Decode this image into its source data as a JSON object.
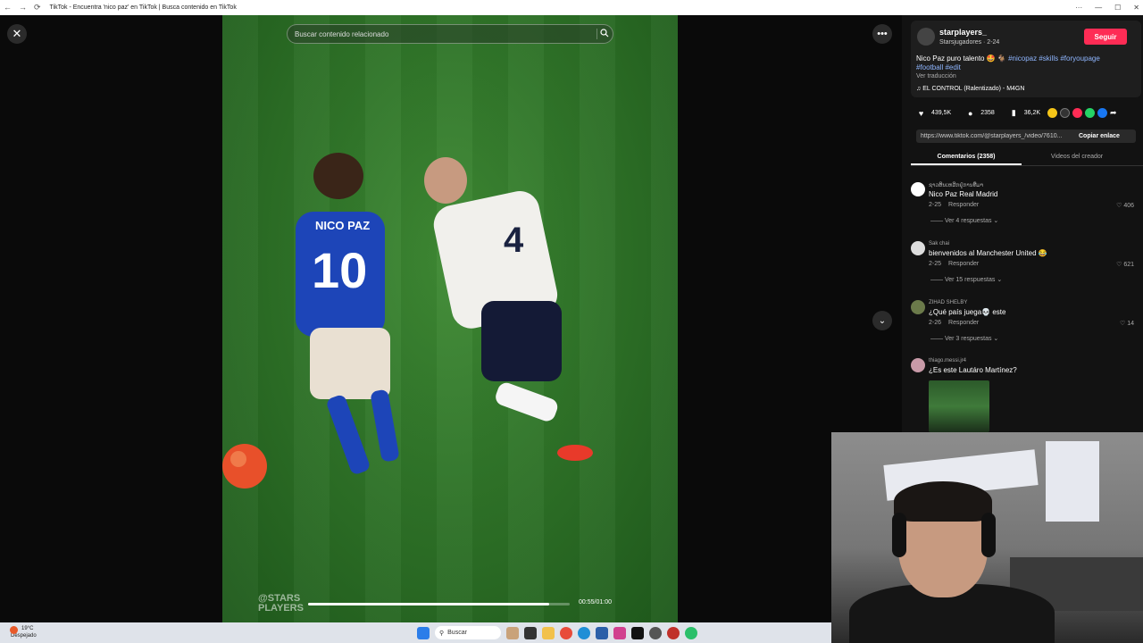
{
  "browser": {
    "tab_title": "TikTok - Encuentra 'nico paz' en TikTok | Busca contenido en TikTok",
    "nav_back": "←",
    "nav_forward": "→",
    "nav_reload": "⟳",
    "win_min": "—",
    "win_max": "☐",
    "win_close": "✕",
    "win_menu": "···"
  },
  "player": {
    "close_label": "✕",
    "search_placeholder": "Buscar contenido relacionado",
    "watermark_line1": "@STARS",
    "watermark_line2": "PLAYERS",
    "time": "00:55/01:00",
    "progress": 0.92,
    "more_label": "•••",
    "down_label": "⌄"
  },
  "post": {
    "username": "starplayers_",
    "subline": "Starsjugadores · 2-24",
    "follow_label": "Seguir",
    "description": "Nico Paz puro talento 🤩 🐐 ",
    "hashtags_line1": "#nicopaz #skills #foryoupage",
    "hashtags_line2": "#football #edit",
    "translate": "Ver traducción",
    "music": "♫  EL CONTROL (Ralentizado) - M4GN",
    "likes": "439,5K",
    "comments": "2358",
    "saves": "36,2K",
    "url": "https://www.tiktok.com/@starplayers_/video/7610...",
    "copy_label": "Copiar enlace"
  },
  "tabs": {
    "comments": "Comentarios (2358)",
    "creator": "Videos del creador"
  },
  "comments": [
    {
      "user": "ຊາວສິນເຫລີກຢູ່ການທີ່ມາ",
      "text": "Nico Paz Real Madrid",
      "date": "2-25",
      "reply": "Responder",
      "likes": "♡ 406",
      "replies": "—— Ver 4 respuestas ⌄"
    },
    {
      "user": "Sak chai",
      "text": "bienvenidos al Manchester United 😂",
      "date": "2-25",
      "reply": "Responder",
      "likes": "♡ 621",
      "replies": "—— Ver 15 respuestas ⌄"
    },
    {
      "user": "ZIHAD SHELBY",
      "text": "¿Qué país juega💀 este",
      "date": "2-26",
      "reply": "Responder",
      "likes": "♡ 14",
      "replies": "—— Ver 3 respuestas ⌄"
    },
    {
      "user": "thiago.messi.jr4",
      "text": "¿Es este Lautáro Martínez?",
      "date": "",
      "reply": "",
      "likes": "",
      "replies": ""
    }
  ],
  "taskbar": {
    "temp": "19°C",
    "weather": "Despejado",
    "search": "Buscar"
  }
}
